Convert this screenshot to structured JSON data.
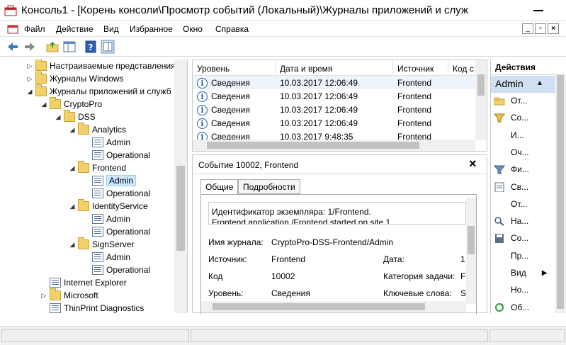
{
  "window": {
    "title": "Консоль1 - [Корень консоли\\Просмотр событий (Локальный)\\Журналы приложений и служ"
  },
  "menu": [
    "Файл",
    "Действие",
    "Вид",
    "Избранное",
    "Окно",
    "Справка"
  ],
  "mdi_buttons": {
    "minimize": "_",
    "restore": "▫",
    "close": "×"
  },
  "tree": [
    {
      "label": "Настраиваемые представления",
      "icon": "folder-icon",
      "indent": 0,
      "expander": "▷"
    },
    {
      "label": "Журналы Windows",
      "icon": "folder-icon",
      "indent": 0,
      "expander": "▷"
    },
    {
      "label": "Журналы приложений и служб",
      "icon": "folder-icon",
      "indent": 0,
      "expander": "◢"
    },
    {
      "label": "CryptoPro",
      "icon": "folder-icon",
      "indent": 1,
      "expander": "◢"
    },
    {
      "label": "DSS",
      "icon": "folder-icon",
      "indent": 2,
      "expander": "◢"
    },
    {
      "label": "Analytics",
      "icon": "folder-icon",
      "indent": 3,
      "expander": "◢"
    },
    {
      "label": "Admin",
      "icon": "log-icon",
      "indent": 4,
      "expander": ""
    },
    {
      "label": "Operational",
      "icon": "log-icon",
      "indent": 4,
      "expander": ""
    },
    {
      "label": "Frontend",
      "icon": "folder-icon",
      "indent": 3,
      "expander": "◢"
    },
    {
      "label": "Admin",
      "icon": "log-icon",
      "indent": 4,
      "expander": "",
      "selected": true
    },
    {
      "label": "Operational",
      "icon": "log-icon",
      "indent": 4,
      "expander": ""
    },
    {
      "label": "IdentityService",
      "icon": "folder-icon",
      "indent": 3,
      "expander": "◢"
    },
    {
      "label": "Admin",
      "icon": "log-icon",
      "indent": 4,
      "expander": ""
    },
    {
      "label": "Operational",
      "icon": "log-icon",
      "indent": 4,
      "expander": ""
    },
    {
      "label": "SignServer",
      "icon": "folder-icon",
      "indent": 3,
      "expander": "◢"
    },
    {
      "label": "Admin",
      "icon": "log-icon",
      "indent": 4,
      "expander": ""
    },
    {
      "label": "Operational",
      "icon": "log-icon",
      "indent": 4,
      "expander": ""
    },
    {
      "label": "Internet Explorer",
      "icon": "log-icon",
      "indent": 1,
      "expander": ""
    },
    {
      "label": "Microsoft",
      "icon": "folder-icon",
      "indent": 1,
      "expander": "▷"
    },
    {
      "label": "ThinPrint Diagnostics",
      "icon": "log-icon",
      "indent": 1,
      "expander": ""
    }
  ],
  "events": {
    "columns": [
      "Уровень",
      "Дата и время",
      "Источник",
      "Код с"
    ],
    "rows": [
      {
        "level": "Сведения",
        "date": "10.03.2017 12:06:49",
        "source": "Frontend"
      },
      {
        "level": "Сведения",
        "date": "10.03.2017 12:06:49",
        "source": "Frontend"
      },
      {
        "level": "Сведения",
        "date": "10.03.2017 12:06:49",
        "source": "Frontend"
      },
      {
        "level": "Сведения",
        "date": "10.03.2017 12:06:49",
        "source": "Frontend"
      },
      {
        "level": "Сведения",
        "date": "10.03.2017 9:48:35",
        "source": "Frontend"
      }
    ]
  },
  "detail": {
    "title": "Событие 10002, Frontend",
    "close": "×",
    "tabs": [
      "Общие",
      "Подробности"
    ],
    "message_line1": "Идентификатор экземпляра: 1/Frontend.",
    "message_line2": "Frontend application /Frontend started on site 1",
    "fields": {
      "log_name_label": "Имя журнала:",
      "log_name_value": "CryptoPro-DSS-Frontend/Admin",
      "source_label": "Источник:",
      "source_value": "Frontend",
      "date_label": "Дата:",
      "date_value": "1",
      "code_label": "Код",
      "code_value": "10002",
      "category_label": "Категория задачи:",
      "category_value": "F",
      "level_label": "Уровень:",
      "level_value": "Сведения",
      "keywords_label": "Ключевые слова:",
      "keywords_value": "S"
    }
  },
  "actions": {
    "header": "Действия",
    "section": "Admin",
    "items": [
      {
        "label": "От...",
        "icon": "open-folder-icon"
      },
      {
        "label": "Со...",
        "icon": "filter-create-icon"
      },
      {
        "label": "И...",
        "icon": ""
      },
      {
        "label": "Оч...",
        "icon": ""
      },
      {
        "label": "Фи...",
        "icon": "filter-icon"
      },
      {
        "label": "Св...",
        "icon": "properties-icon"
      },
      {
        "label": "От...",
        "icon": ""
      },
      {
        "label": "На...",
        "icon": "find-icon"
      },
      {
        "label": "Со...",
        "icon": "save-icon"
      },
      {
        "label": "Пр...",
        "icon": ""
      },
      {
        "label": "Вид",
        "icon": "",
        "submenu": "▶"
      },
      {
        "label": "Но...",
        "icon": ""
      },
      {
        "label": "Об...",
        "icon": "refresh-icon"
      }
    ]
  }
}
